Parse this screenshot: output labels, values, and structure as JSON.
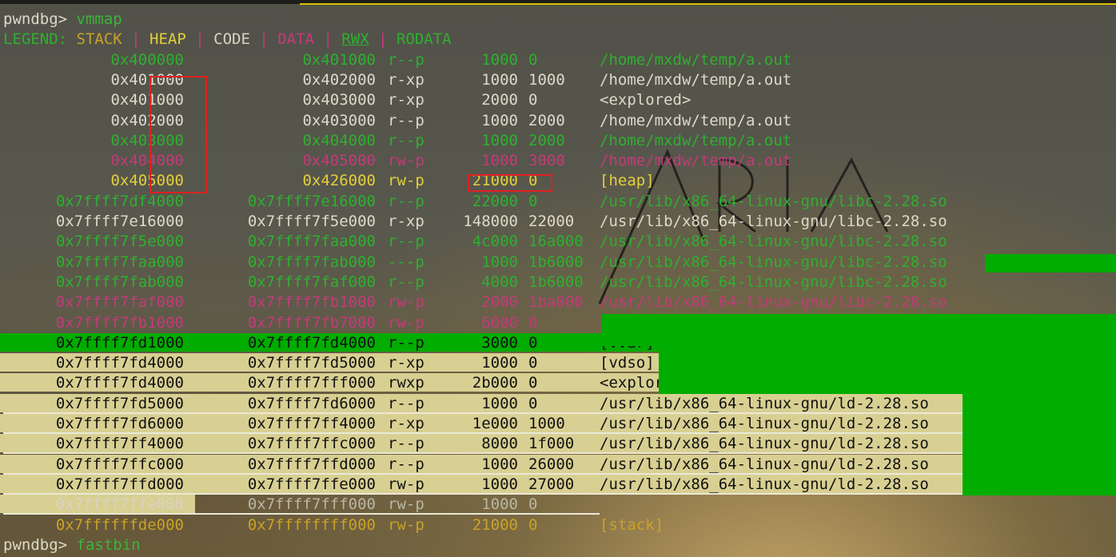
{
  "prompt": "pwndbg>",
  "command": "vmmap",
  "legend": {
    "label": "LEGEND:",
    "items": [
      {
        "text": "STACK",
        "color": "#c9a227"
      },
      {
        "text": "HEAP",
        "color": "#e3cf3a"
      },
      {
        "text": "CODE",
        "color": "#d7d4c3"
      },
      {
        "text": "DATA",
        "color": "#c23b7a"
      },
      {
        "text": "RWX",
        "color": "#2faf2f"
      },
      {
        "text": "RODATA",
        "color": "#2faf2f"
      }
    ],
    "separator": "|"
  },
  "rows": [
    {
      "start": "0x400000",
      "end": "0x401000",
      "perm": "r--p",
      "size": "1000",
      "offset": "0",
      "path": "/home/mxdw/temp/a.out",
      "color": "#2faf2f"
    },
    {
      "start": "0x401000",
      "end": "0x402000",
      "perm": "r-xp",
      "size": "1000",
      "offset": "1000",
      "path": "/home/mxdw/temp/a.out",
      "color": "#dcdac8"
    },
    {
      "start": "0x401000",
      "end": "0x403000",
      "perm": "r-xp",
      "size": "2000",
      "offset": "0",
      "path": "<explored>",
      "color": "#dcdac8"
    },
    {
      "start": "0x402000",
      "end": "0x403000",
      "perm": "r--p",
      "size": "1000",
      "offset": "2000",
      "path": "/home/mxdw/temp/a.out",
      "color": "#dcdac8"
    },
    {
      "start": "0x403000",
      "end": "0x404000",
      "perm": "r--p",
      "size": "1000",
      "offset": "2000",
      "path": "/home/mxdw/temp/a.out",
      "color": "#2faf2f"
    },
    {
      "start": "0x404000",
      "end": "0x405000",
      "perm": "rw-p",
      "size": "1000",
      "offset": "3000",
      "path": "/home/mxdw/temp/a.out",
      "color": "#c23b7a"
    },
    {
      "start": "0x405000",
      "end": "0x426000",
      "perm": "rw-p",
      "size": "21000",
      "offset": "0",
      "path": "[heap]",
      "color": "#e3cf3a"
    },
    {
      "start": "0x7ffff7df4000",
      "end": "0x7ffff7e16000",
      "perm": "r--p",
      "size": "22000",
      "offset": "0",
      "path": "/usr/lib/x86_64-linux-gnu/libc-2.28.so",
      "color": "#2faf2f"
    },
    {
      "start": "0x7ffff7e16000",
      "end": "0x7ffff7f5e000",
      "perm": "r-xp",
      "size": "148000",
      "offset": "22000",
      "path": "/usr/lib/x86_64-linux-gnu/libc-2.28.so",
      "color": "#dcdac8"
    },
    {
      "start": "0x7ffff7f5e000",
      "end": "0x7ffff7faa000",
      "perm": "r--p",
      "size": "4c000",
      "offset": "16a000",
      "path": "/usr/lib/x86_64-linux-gnu/libc-2.28.so",
      "color": "#2faf2f"
    },
    {
      "start": "0x7ffff7faa000",
      "end": "0x7ffff7fab000",
      "perm": "---p",
      "size": "1000",
      "offset": "1b6000",
      "path": "/usr/lib/x86_64-linux-gnu/libc-2.28.so",
      "color": "#2faf2f"
    },
    {
      "start": "0x7ffff7fab000",
      "end": "0x7ffff7faf000",
      "perm": "r--p",
      "size": "4000",
      "offset": "1b6000",
      "path": "/usr/lib/x86_64-linux-gnu/libc-2.28.so",
      "color": "#2faf2f"
    },
    {
      "start": "0x7ffff7faf000",
      "end": "0x7ffff7fb1000",
      "perm": "rw-p",
      "size": "2000",
      "offset": "1ba000",
      "path": "/usr/lib/x86_64-linux-gnu/libc-2.28.so",
      "color": "#c23b7a"
    },
    {
      "start": "0x7ffff7fb1000",
      "end": "0x7ffff7fb7000",
      "perm": "rw-p",
      "size": "6000",
      "offset": "0",
      "path": "",
      "color": "#c23b7a"
    },
    {
      "start": "0x7ffff7fd1000",
      "end": "0x7ffff7fd4000",
      "perm": "r--p",
      "size": "3000",
      "offset": "0",
      "path": "[vvar]",
      "color": "#111111"
    },
    {
      "start": "0x7ffff7fd4000",
      "end": "0x7ffff7fd5000",
      "perm": "r-xp",
      "size": "1000",
      "offset": "0",
      "path": "[vdso]",
      "color": "#111111"
    },
    {
      "start": "0x7ffff7fd4000",
      "end": "0x7ffff7fff000",
      "perm": "rwxp",
      "size": "2b000",
      "offset": "0",
      "path": "<explored>",
      "color": "#111111"
    },
    {
      "start": "0x7ffff7fd5000",
      "end": "0x7ffff7fd6000",
      "perm": "r--p",
      "size": "1000",
      "offset": "0",
      "path": "/usr/lib/x86_64-linux-gnu/ld-2.28.so",
      "color": "#111111"
    },
    {
      "start": "0x7ffff7fd6000",
      "end": "0x7ffff7ff4000",
      "perm": "r-xp",
      "size": "1e000",
      "offset": "1000",
      "path": "/usr/lib/x86_64-linux-gnu/ld-2.28.so",
      "color": "#111111"
    },
    {
      "start": "0x7ffff7ff4000",
      "end": "0x7ffff7ffc000",
      "perm": "r--p",
      "size": "8000",
      "offset": "1f000",
      "path": "/usr/lib/x86_64-linux-gnu/ld-2.28.so",
      "color": "#111111"
    },
    {
      "start": "0x7ffff7ffc000",
      "end": "0x7ffff7ffd000",
      "perm": "r--p",
      "size": "1000",
      "offset": "26000",
      "path": "/usr/lib/x86_64-linux-gnu/ld-2.28.so",
      "color": "#111111"
    },
    {
      "start": "0x7ffff7ffd000",
      "end": "0x7ffff7ffe000",
      "perm": "rw-p",
      "size": "1000",
      "offset": "27000",
      "path": "/usr/lib/x86_64-linux-gnu/ld-2.28.so",
      "color": "#111111"
    },
    {
      "start": "0x7ffff7ffe000",
      "end": "0x7ffff7fff000",
      "perm": "rw-p",
      "size": "1000",
      "offset": "0",
      "path": "",
      "color": "#d7d4c3"
    },
    {
      "start": "0x7ffffffde000",
      "end": "0x7ffffffff000",
      "perm": "rw-p",
      "size": "21000",
      "offset": "0",
      "path": "[stack]",
      "color": "#c9a227"
    }
  ],
  "next_command": "fastbin",
  "watermark": "ARIA",
  "colors": {
    "highlight_green": "#00ad00",
    "selection_tan": "#d8cf92",
    "annotation_red": "#e02020"
  }
}
